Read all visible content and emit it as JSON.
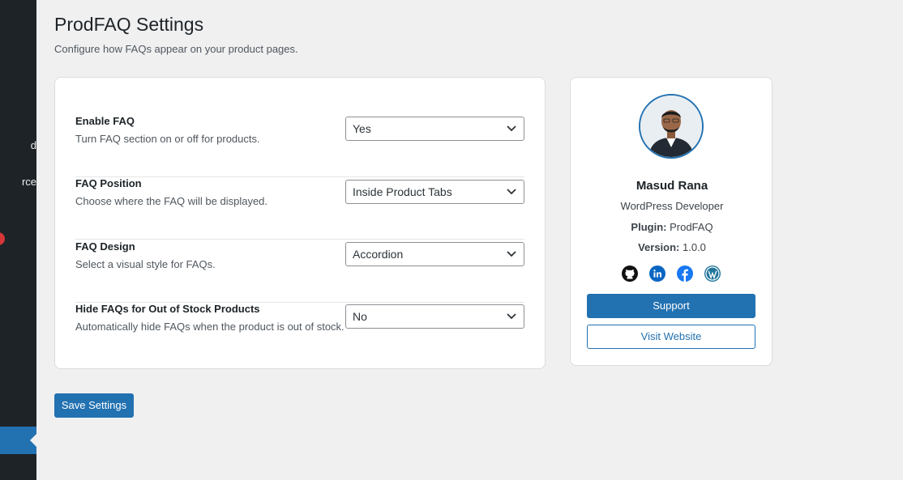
{
  "sidebar": {
    "items": [
      {
        "label": "d"
      },
      {
        "label": "rce"
      }
    ]
  },
  "page": {
    "title": "ProdFAQ Settings",
    "subtitle": "Configure how FAQs appear on your product pages."
  },
  "settings": [
    {
      "label": "Enable FAQ",
      "description": "Turn FAQ section on or off for products.",
      "value": "Yes"
    },
    {
      "label": "FAQ Position",
      "description": "Choose where the FAQ will be displayed.",
      "value": "Inside Product Tabs"
    },
    {
      "label": "FAQ Design",
      "description": "Select a visual style for FAQs.",
      "value": "Accordion"
    },
    {
      "label": "Hide FAQs for Out of Stock Products",
      "description": "Automatically hide FAQs when the product is out of stock.",
      "value": "No"
    }
  ],
  "save_label": "Save Settings",
  "profile": {
    "name": "Masud Rana",
    "role": "WordPress Developer",
    "plugin_label": "Plugin:",
    "plugin_value": "ProdFAQ",
    "version_label": "Version:",
    "version_value": "1.0.0",
    "socials": [
      "github-icon",
      "linkedin-icon",
      "facebook-icon",
      "wordpress-icon"
    ],
    "support_label": "Support",
    "visit_label": "Visit Website"
  },
  "colors": {
    "primary": "#2271b1",
    "sidebar": "#1d2327",
    "background": "#f0f0f1",
    "badge": "#d63638"
  }
}
